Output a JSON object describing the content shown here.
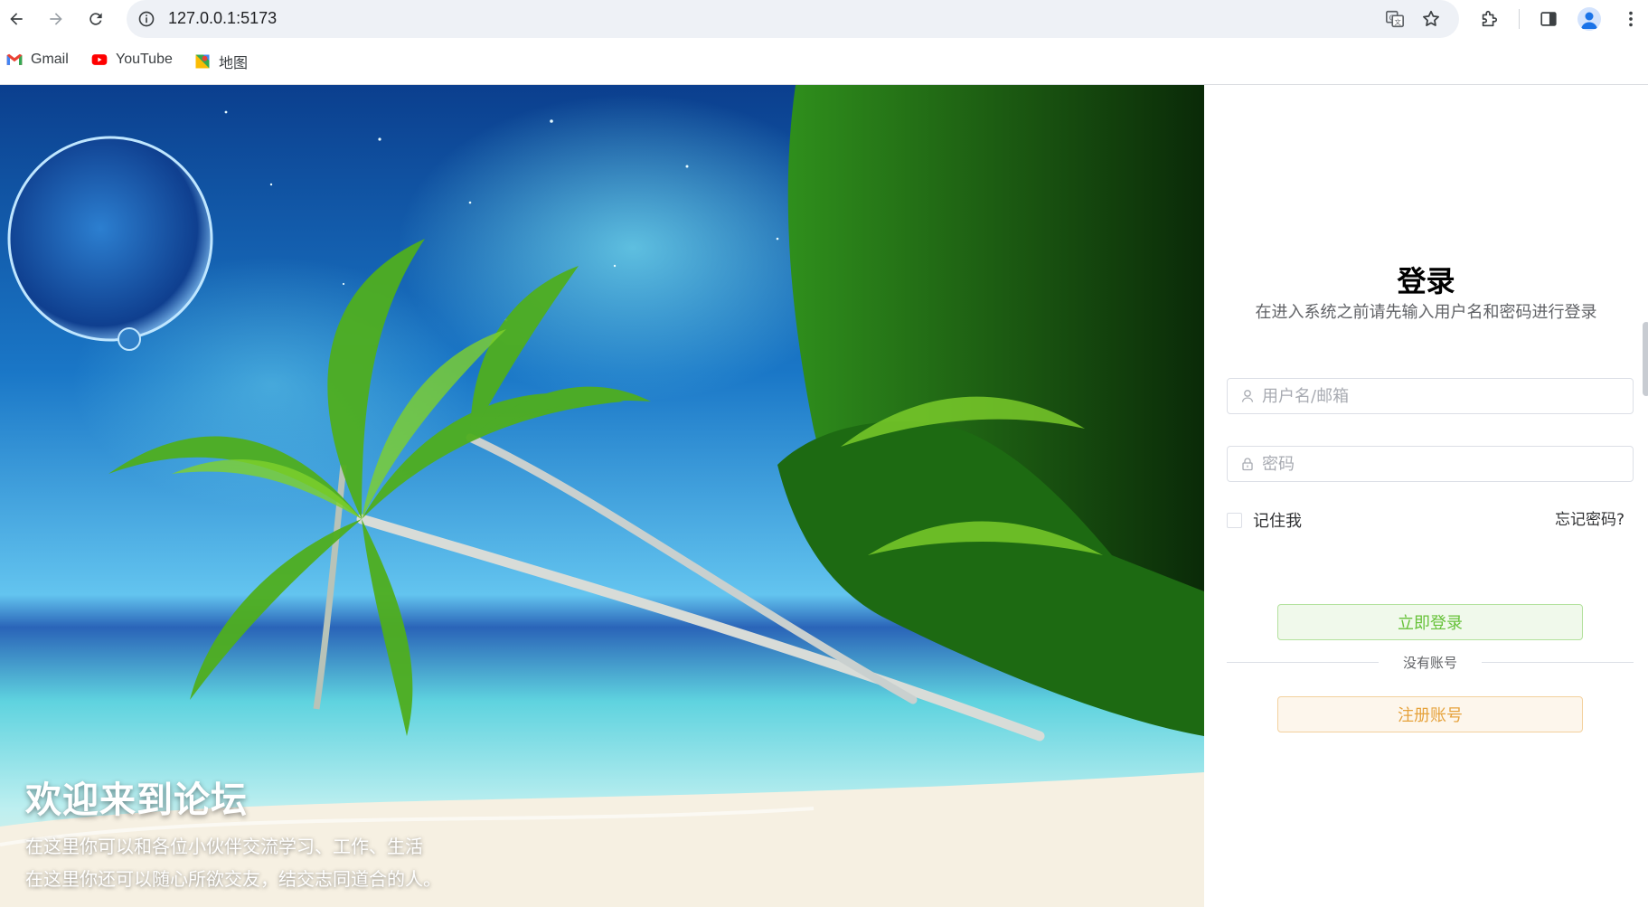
{
  "browser": {
    "url": "127.0.0.1:5173",
    "bookmarks": [
      {
        "label": "Gmail",
        "icon": "gmail-icon"
      },
      {
        "label": "YouTube",
        "icon": "youtube-icon"
      },
      {
        "label": "地图",
        "icon": "maps-icon"
      }
    ]
  },
  "hero": {
    "title": "欢迎来到论坛",
    "line1": "在这里你可以和各位小伙伴交流学习、工作、生活",
    "line2": "在这里你还可以随心所欲交友，结交志同道合的人。"
  },
  "login": {
    "title": "登录",
    "subtitle": "在进入系统之前请先输入用户名和密码进行登录",
    "username_placeholder": "用户名/邮箱",
    "password_placeholder": "密码",
    "remember_label": "记住我",
    "forgot_label": "忘记密码?",
    "login_button": "立即登录",
    "divider_text": "没有账号",
    "register_button": "注册账号"
  },
  "colors": {
    "login_button_text": "#67c23a",
    "register_button_text": "#e6a23c"
  }
}
